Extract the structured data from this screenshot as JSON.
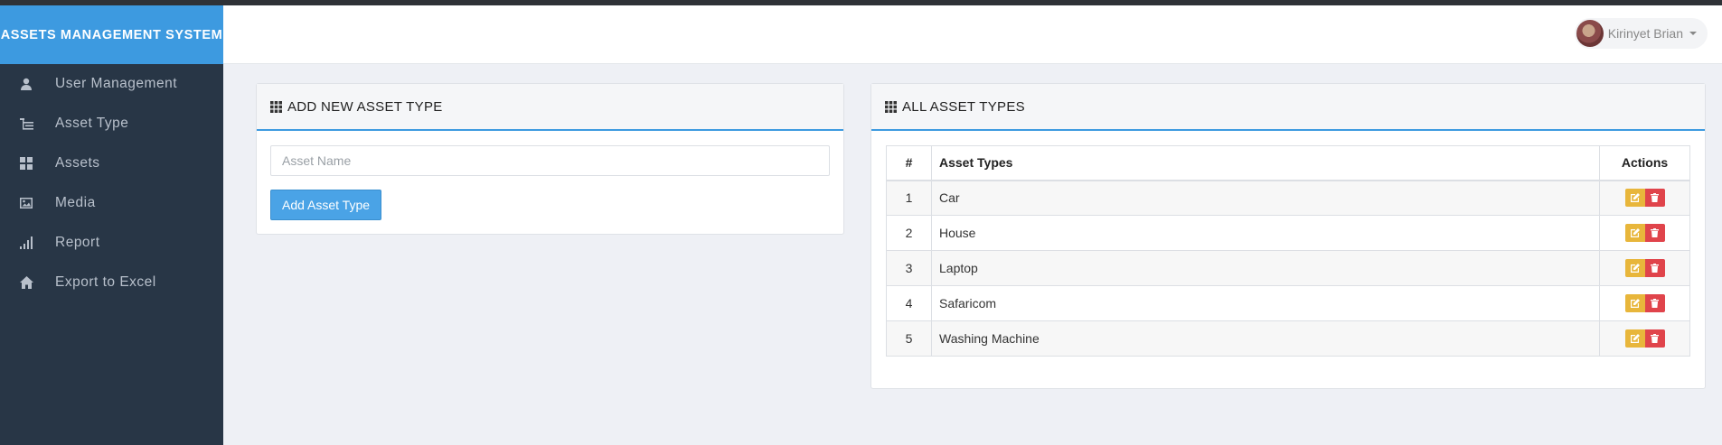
{
  "app": {
    "brand": "ASSETS MANAGEMENT SYSTEM"
  },
  "sidebar": {
    "items": [
      {
        "label": "User Management",
        "icon": "user-icon"
      },
      {
        "label": "Asset Type",
        "icon": "list-tree-icon"
      },
      {
        "label": "Assets",
        "icon": "th-large-icon"
      },
      {
        "label": "Media",
        "icon": "picture-icon"
      },
      {
        "label": "Report",
        "icon": "signal-bars-icon"
      },
      {
        "label": "Export to Excel",
        "icon": "home-icon"
      }
    ]
  },
  "header": {
    "user_name": "Kirinyet Brian"
  },
  "add_panel": {
    "title": "ADD NEW ASSET TYPE",
    "input_placeholder": "Asset Name",
    "input_value": "",
    "button_label": "Add Asset Type"
  },
  "list_panel": {
    "title": "ALL ASSET TYPES",
    "columns": [
      "#",
      "Asset Types",
      "Actions"
    ],
    "rows": [
      {
        "num": "1",
        "name": "Car"
      },
      {
        "num": "2",
        "name": "House"
      },
      {
        "num": "3",
        "name": "Laptop"
      },
      {
        "num": "4",
        "name": "Safaricom"
      },
      {
        "num": "5",
        "name": "Washing Machine"
      }
    ]
  },
  "colors": {
    "brand_blue": "#3d9ae0",
    "sidebar_bg": "#283646",
    "edit_button": "#e8b63b",
    "delete_button": "#e0444b",
    "primary_button": "#4aa3e6"
  }
}
